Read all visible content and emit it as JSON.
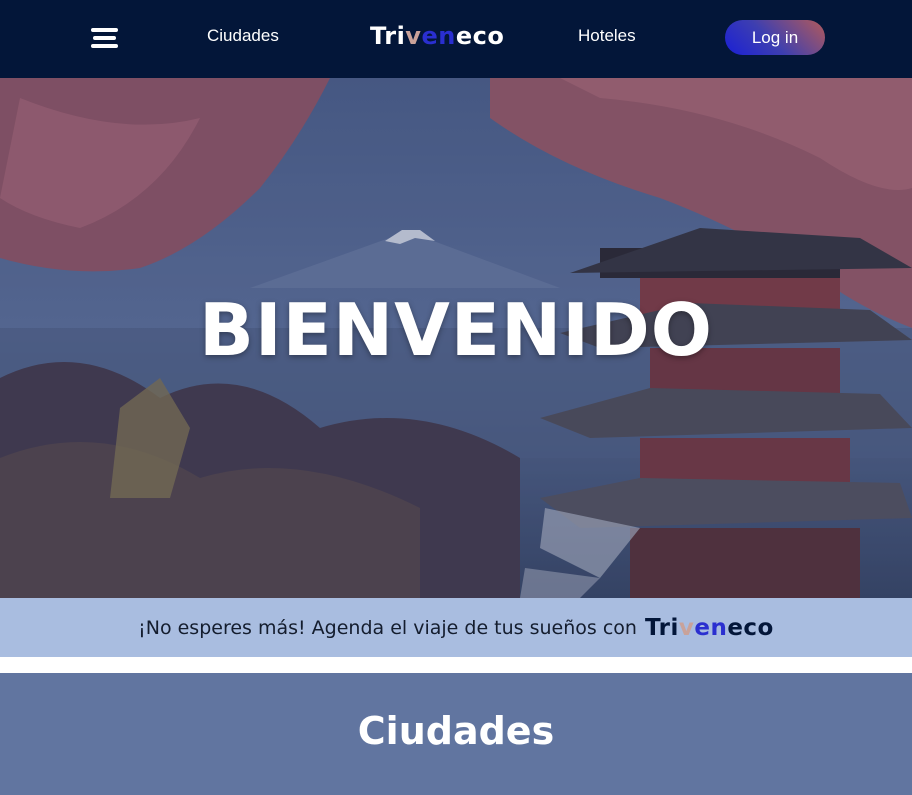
{
  "navbar": {
    "menu_icon": "hamburger-menu-icon",
    "links": {
      "cities": "Ciudades",
      "hotels": "Hoteles"
    },
    "brand": {
      "part1": "Tri",
      "part2": "v",
      "part3": "en",
      "part4": "eco",
      "colors": {
        "part1": "#ffffff",
        "part2": "#c9a29a",
        "part3": "#2a2fd0",
        "part4": "#ffffff"
      }
    },
    "login_label": "Log in"
  },
  "hero": {
    "title": "BIENVENIDO"
  },
  "banner": {
    "text": "¡No esperes más! Agenda el viaje de tus sueños con",
    "brand": {
      "part1": "Tri",
      "part2": "v",
      "part3": "en",
      "part4": "eco"
    }
  },
  "section": {
    "title": "Ciudades"
  },
  "colors": {
    "navbar_bg": "#031639",
    "banner_bg": "#a9bde0",
    "section_bg": "#6175a0"
  }
}
